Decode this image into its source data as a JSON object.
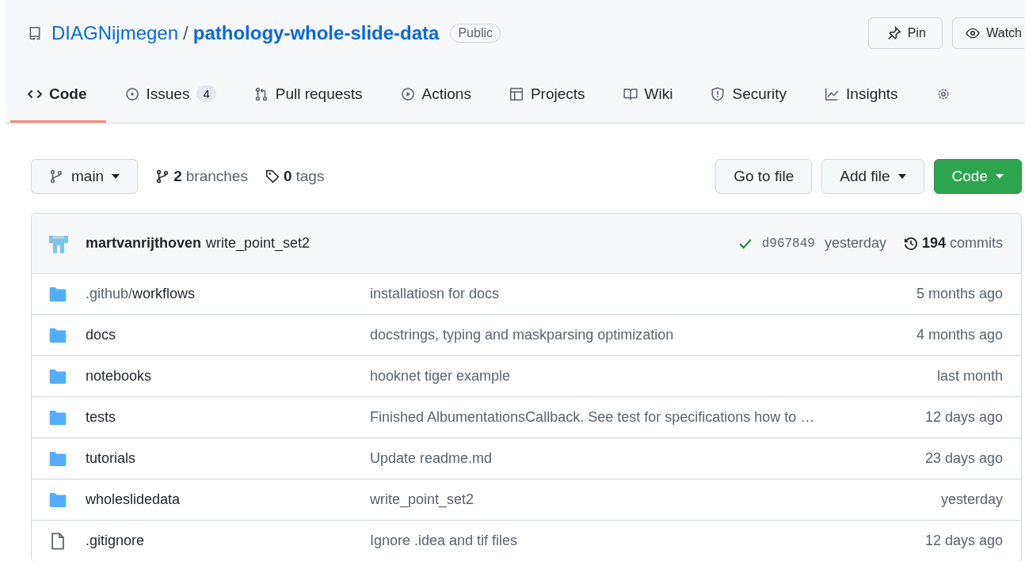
{
  "repo": {
    "owner": "DIAGNijmegen",
    "separator": "/",
    "name": "pathology-whole-slide-data",
    "visibility": "Public"
  },
  "header_buttons": [
    {
      "kind": "pin",
      "label": "Pin"
    },
    {
      "kind": "watch",
      "label": "Watch"
    }
  ],
  "tabs": [
    {
      "kind": "code",
      "label": "Code",
      "selected": true
    },
    {
      "kind": "issue",
      "label": "Issues",
      "counter": "4",
      "selected": false
    },
    {
      "kind": "pull",
      "label": "Pull requests",
      "selected": false
    },
    {
      "kind": "play",
      "label": "Actions",
      "selected": false
    },
    {
      "kind": "table",
      "label": "Projects",
      "selected": false
    },
    {
      "kind": "book",
      "label": "Wiki",
      "selected": false
    },
    {
      "kind": "shield",
      "label": "Security",
      "selected": false
    },
    {
      "kind": "graph",
      "label": "Insights",
      "selected": false
    },
    {
      "kind": "gear",
      "selected": false
    }
  ],
  "branch_bar": {
    "branch": "main",
    "branches_count": "2",
    "branches_label": "branches",
    "tags_count": "0",
    "tags_label": "tags",
    "buttons": [
      {
        "kind": "plain",
        "label": "Go to file",
        "dropdown": false
      },
      {
        "kind": "plain",
        "label": "Add file",
        "dropdown": true
      },
      {
        "kind": "primary",
        "label": "Code",
        "dropdown": true
      }
    ]
  },
  "latest_commit": {
    "author": "martvanrijthoven",
    "message": "write_point_set2",
    "checks_passed": true,
    "sha": "d967849",
    "time": "yesterday",
    "commits_count": "194",
    "commits_label": "commits"
  },
  "files": [
    {
      "kind": "folder",
      "prefix": ".github/",
      "name": "workflows",
      "message": "installatiosn for docs",
      "age": "5 months ago"
    },
    {
      "kind": "folder",
      "name": "docs",
      "message": "docstrings, typing and maskparsing optimization",
      "age": "4 months ago"
    },
    {
      "kind": "folder",
      "name": "notebooks",
      "message": "hooknet tiger example",
      "age": "last month"
    },
    {
      "kind": "folder",
      "name": "tests",
      "message": "Finished AlbumentationsCallback. See test for specifications how to …",
      "age": "12 days ago"
    },
    {
      "kind": "folder",
      "name": "tutorials",
      "message": "Update readme.md",
      "age": "23 days ago"
    },
    {
      "kind": "folder",
      "name": "wholeslidedata",
      "message": "write_point_set2",
      "age": "yesterday"
    },
    {
      "kind": "file",
      "name": ".gitignore",
      "message": "Ignore .idea and tif files",
      "age": "12 days ago"
    }
  ]
}
